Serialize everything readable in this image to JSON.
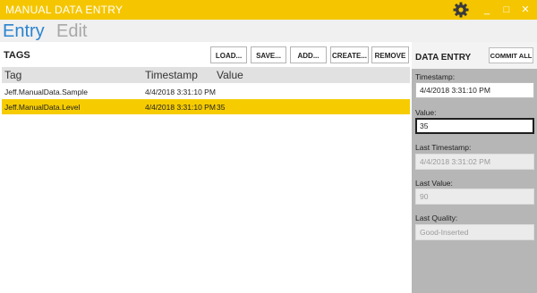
{
  "app": {
    "title": "MANUAL DATA ENTRY",
    "controls": {
      "minimize": "_",
      "maximize": "□",
      "close": "✕"
    }
  },
  "tabs": [
    {
      "label": "Entry",
      "active": true
    },
    {
      "label": "Edit",
      "active": false
    }
  ],
  "tags_section": {
    "title": "TAGS",
    "buttons": {
      "load": "LOAD...",
      "save": "SAVE...",
      "add": "ADD...",
      "create": "CREATE...",
      "remove": "REMOVE"
    }
  },
  "table": {
    "columns": [
      "Tag",
      "Timestamp",
      "Value"
    ],
    "rows": [
      {
        "tag": "Jeff.ManualData.Sample",
        "timestamp": "4/4/2018 3:31:10 PM",
        "value": "",
        "selected": false
      },
      {
        "tag": "Jeff.ManualData.Level",
        "timestamp": "4/4/2018 3:31:10 PM",
        "value": "35",
        "selected": true
      }
    ]
  },
  "data_entry": {
    "title": "DATA ENTRY",
    "commit_label": "COMMIT ALL",
    "timestamp_label": "Timestamp:",
    "timestamp_value": "4/4/2018 3:31:10 PM",
    "value_label": "Value:",
    "value_value": "35",
    "last_timestamp_label": "Last Timestamp:",
    "last_timestamp_value": "4/4/2018 3:31:02 PM",
    "last_value_label": "Last Value:",
    "last_value_value": "90",
    "last_quality_label": "Last Quality:",
    "last_quality_value": "Good-Inserted"
  },
  "colors": {
    "accent": "#f5c600",
    "selected_row": "#f6cc00",
    "tab_active": "#2a84cf",
    "tab_inactive": "#a8a8a8",
    "panel_bg": "#b6b6b6"
  },
  "icons": {
    "settings": "gear-icon"
  }
}
